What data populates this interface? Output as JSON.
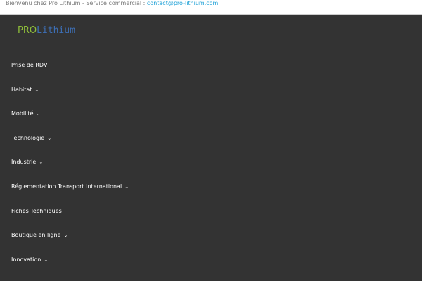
{
  "topbar": {
    "text": "Bienvenu chez Pro Lithium - Service commercial : ",
    "email": "contact@pro-lithium.com"
  },
  "logo": {
    "pro": "PRO",
    "lithium": "Lithium"
  },
  "nav": [
    {
      "label": "Prise de RDV",
      "dropdown": false
    },
    {
      "label": "Habitat",
      "dropdown": true
    },
    {
      "label": "Mobilité",
      "dropdown": true
    },
    {
      "label": "Technologie",
      "dropdown": true
    },
    {
      "label": "Industrie",
      "dropdown": true
    },
    {
      "label": "Réglementation Transport International",
      "dropdown": true
    },
    {
      "label": "Fiches Techniques",
      "dropdown": false
    },
    {
      "label": "Boutique en ligne",
      "dropdown": true
    },
    {
      "label": "Innovation",
      "dropdown": true
    }
  ]
}
